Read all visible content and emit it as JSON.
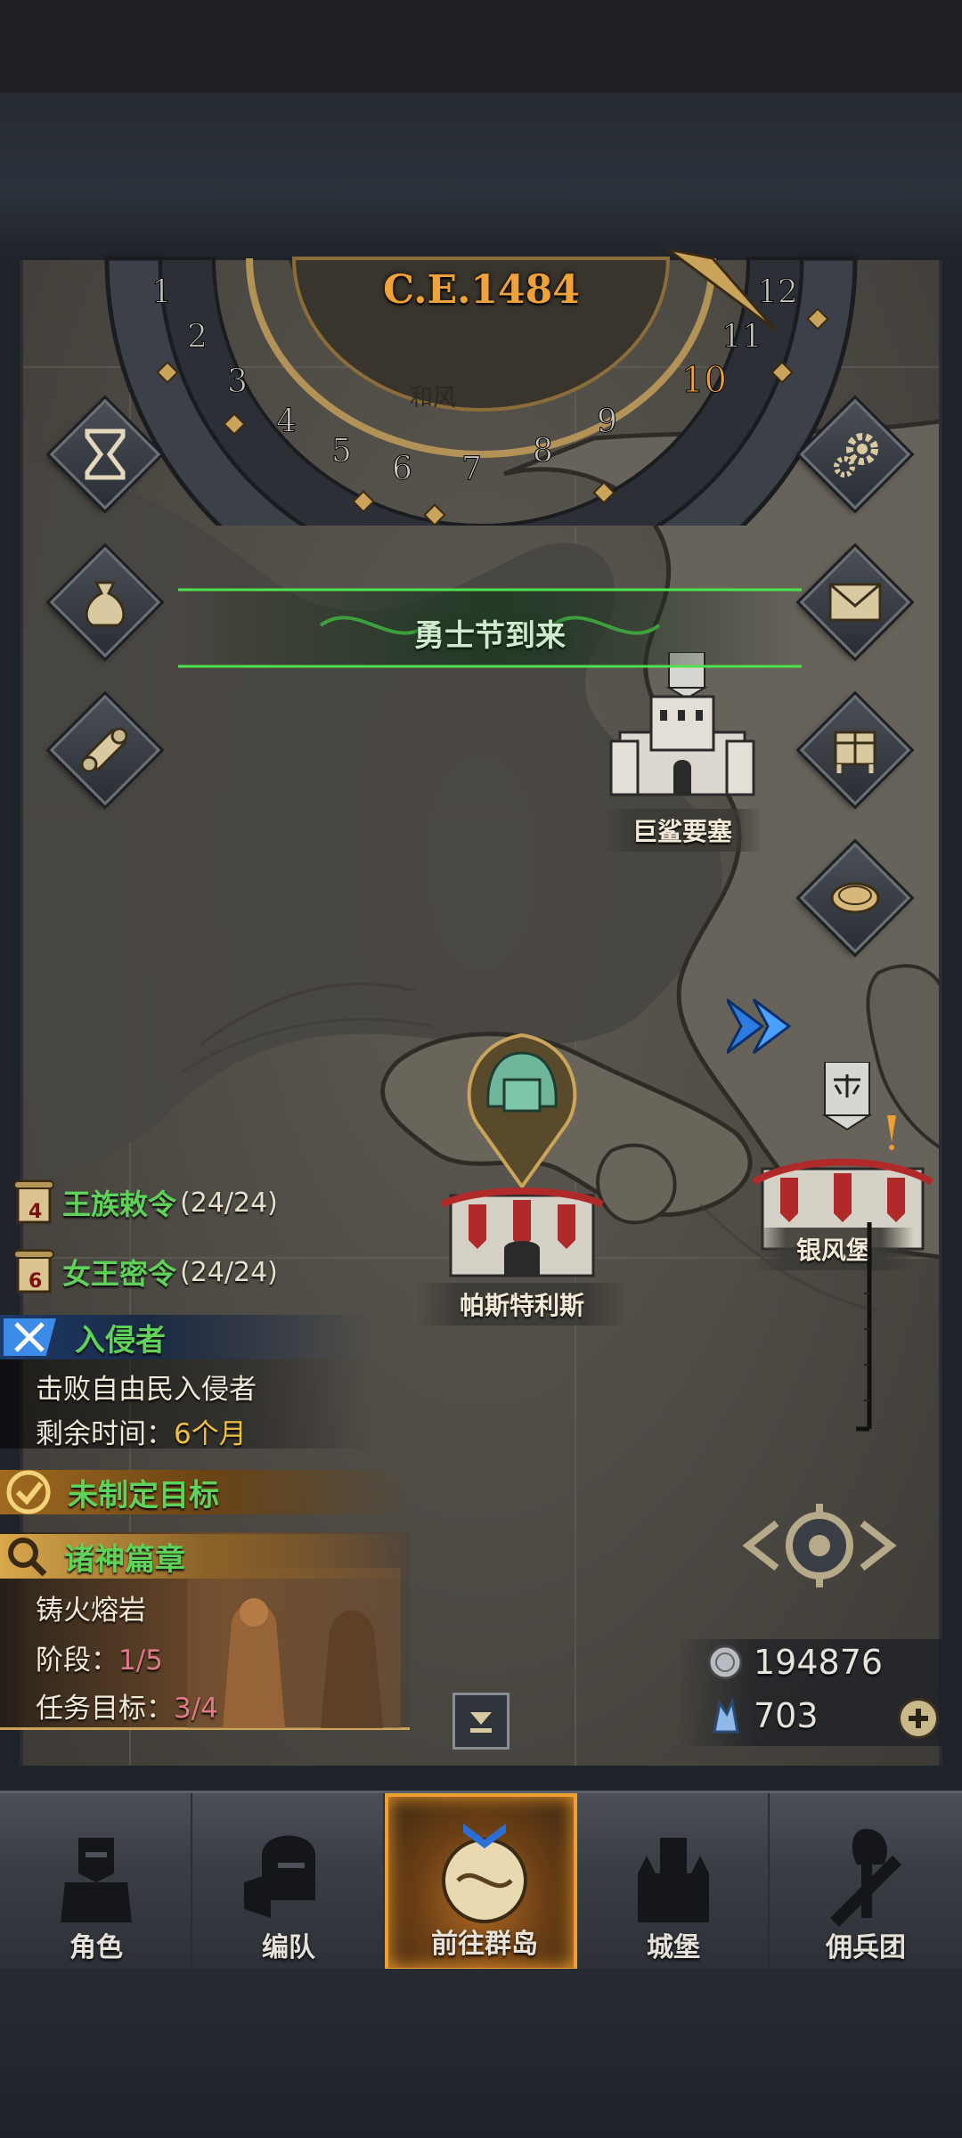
{
  "calendar": {
    "year": "C.E.1484",
    "months": [
      "1",
      "2",
      "3",
      "4",
      "5",
      "6",
      "7",
      "8",
      "9",
      "10",
      "11",
      "12"
    ],
    "current_month": "10",
    "partial_place_label": "和风"
  },
  "banner": {
    "text": "勇士节到来"
  },
  "locations": {
    "fortress": "巨鲨要塞",
    "capital": "帕斯特利斯",
    "silverwind": "银风堡"
  },
  "orders": [
    {
      "label": "王族敕令",
      "count": "(24/24)",
      "badge": "4"
    },
    {
      "label": "女王密令",
      "count": "(24/24)",
      "badge": "6"
    }
  ],
  "invader": {
    "title": "入侵者",
    "desc": "击败自由民入侵者",
    "time_label": "剩余时间：",
    "time_value": "6个月"
  },
  "goal": {
    "title": "未制定目标"
  },
  "chapter": {
    "title": "诸神篇章",
    "name": "铸火熔岩",
    "stage_label": "阶段：",
    "stage_value": "1/5",
    "task_label": "任务目标：",
    "task_value": "3/4"
  },
  "resources": {
    "silver": "194876",
    "crystal": "703"
  },
  "nav": [
    {
      "label": "角色",
      "icon": "knight-icon"
    },
    {
      "label": "编队",
      "icon": "helmet-icon"
    },
    {
      "label": "前往群岛",
      "icon": "compass-icon"
    },
    {
      "label": "城堡",
      "icon": "castle-icon"
    },
    {
      "label": "佣兵团",
      "icon": "mercenary-icon"
    }
  ],
  "colors": {
    "accent_orange": "#f0a23a",
    "quest_green": "#5fd25a",
    "active_tab": "#f0a030"
  }
}
